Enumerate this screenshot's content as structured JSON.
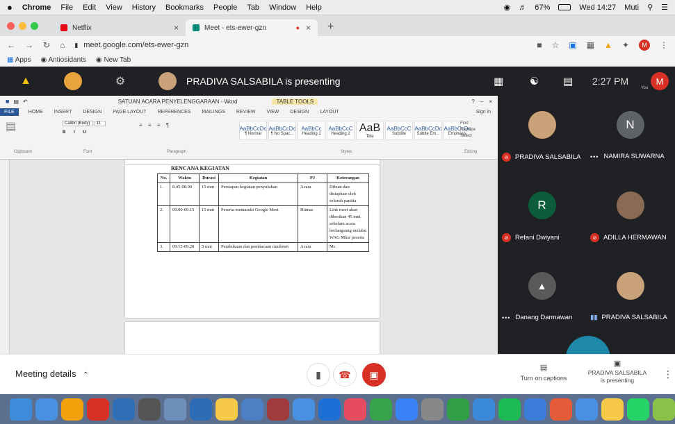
{
  "macos_menu": {
    "apple_icon": "apple-icon",
    "app": "Chrome",
    "items": [
      "File",
      "Edit",
      "View",
      "History",
      "Bookmarks",
      "People",
      "Tab",
      "Window",
      "Help"
    ],
    "battery": "67%",
    "clock": "Wed 14:27",
    "user": "Muti"
  },
  "browser": {
    "tabs": [
      {
        "title": "Netflix",
        "favicon_color": "#e50914"
      },
      {
        "title": "Meet - ets-ewer-gzn",
        "favicon_color": "#00897b"
      }
    ],
    "url": "meet.google.com/ets-ewer-gzn",
    "bookmarks": [
      "Apps",
      "Antiosidants",
      "New Tab"
    ]
  },
  "meet_bar": {
    "presenter_text": "PRADIVA SALSABILA is presenting",
    "time": "2:27 PM",
    "self_avatar": "M",
    "self_label": "You"
  },
  "word": {
    "title": "SATUAN ACARA PENYELENGGARAAN - Word",
    "tools": "TABLE TOOLS",
    "tabs": [
      "FILE",
      "HOME",
      "INSERT",
      "DESIGN",
      "PAGE LAYOUT",
      "REFERENCES",
      "MAILINGS",
      "REVIEW",
      "VIEW",
      "DESIGN",
      "LAYOUT"
    ],
    "sign_in": "Sign in",
    "font": "Calibri (Body)",
    "font_size": "11",
    "styles": [
      {
        "sample": "AaBbCcDc",
        "name": "¶ Normal"
      },
      {
        "sample": "AaBbCcDc",
        "name": "¶ No Spac..."
      },
      {
        "sample": "AaBbCc",
        "name": "Heading 1"
      },
      {
        "sample": "AaBbCcC",
        "name": "Heading 2"
      },
      {
        "sample": "AaB",
        "name": "Title"
      },
      {
        "sample": "AaBbCcC",
        "name": "Subtitle"
      },
      {
        "sample": "AaBbCcDc",
        "name": "Subtle Em..."
      },
      {
        "sample": "AaBbCcDc",
        "name": "Emphasis"
      }
    ],
    "editing": [
      "Find",
      "Replace",
      "Select"
    ],
    "groups": [
      "Clipboard",
      "Font",
      "Paragraph",
      "Styles",
      "Editing"
    ],
    "doc_title": "RENCANA KEGIATAN",
    "table": {
      "headers": [
        "No.",
        "Waktu",
        "Durasi",
        "Kegiatan",
        "PJ",
        "Keterangan"
      ],
      "rows": [
        [
          "1.",
          "8.45-08.00",
          "15 mnt",
          "Persiapan kegiatan penyuluhan",
          "Acara",
          "Dibuat dan disiapkan oleh seluruh panitia"
        ],
        [
          "2.",
          "09.00-09.15",
          "15 mnt",
          "Peserta memasuki Google Meet",
          "Humas",
          "Link meet akan diberikan 45 mnt sebelum acara berlangsung melalui WAG Mhsr peserta"
        ],
        [
          "3.",
          "09.15-09.20",
          "5 mnt",
          "Pembukaan dan pembacaan rundown",
          "Acara",
          "Mc"
        ]
      ]
    }
  },
  "participants": [
    {
      "name": "PRADIVA SALSABILA",
      "initial": "",
      "status": "muted",
      "color": "#c9a27a"
    },
    {
      "name": "NAMIRA SUWARNA",
      "initial": "N",
      "status": "dots",
      "color": "#5f6368"
    },
    {
      "name": "Refani Dwiyani",
      "initial": "R",
      "status": "muted",
      "color": "#0b5d3b"
    },
    {
      "name": "ADILLA HERMAWAN",
      "initial": "",
      "status": "muted",
      "color": "#8a6a52"
    },
    {
      "name": "Danang Darmawan",
      "initial": "",
      "status": "dots",
      "color": "#5a5a5a"
    },
    {
      "name": "PRADIVA SALSABILA",
      "initial": "",
      "status": "speaking",
      "color": "#c9a27a"
    }
  ],
  "controls": {
    "meeting_details": "Meeting details",
    "captions_label": "Turn on captions",
    "presenting_name": "PRADIVA SALSABILA",
    "presenting_label": "is presenting",
    "end_call_color": "#d93025",
    "cam_off_color": "#d93025"
  },
  "dock_colors": [
    "#3d8bd9",
    "#4a90e2",
    "#f2a20c",
    "#d93025",
    "#2f6fb5",
    "#555",
    "#6b8fb8",
    "#2c6db5",
    "#f7c948",
    "#4c7fc4",
    "#a13a3a",
    "#4a90e2",
    "#1d6fd6",
    "#e84a5f",
    "#37a34a",
    "#3b82f6",
    "#888",
    "#2f9e44",
    "#3b8ad9",
    "#1db954",
    "#3b7dd8",
    "#e65c3a",
    "#4a90e2",
    "#f7c948",
    "#25d366",
    "#8bc34a",
    "#dfe3ea"
  ]
}
